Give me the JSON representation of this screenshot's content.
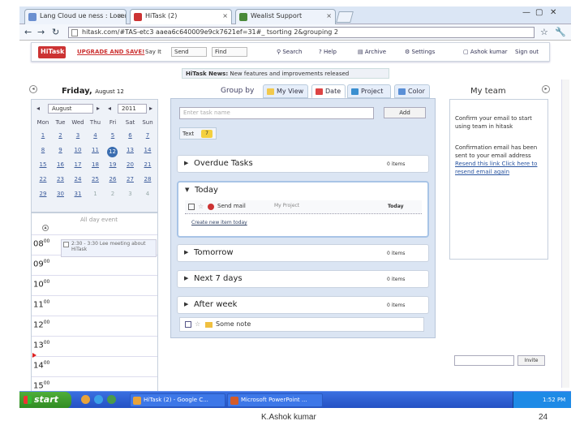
{
  "browser": {
    "tabs": [
      {
        "label": "Lang Cloud ue ness : Locen"
      },
      {
        "label": "HiTask (2)"
      },
      {
        "label": "Wealist Support"
      }
    ],
    "url": "hitask.com/#TAS-etc3 aaea6c640009e9ck7621ef=31#_ tsorting 2&grouping 2"
  },
  "hitask": {
    "logo": "HiTask",
    "upgrade": "UPGRADE AND SAVE!",
    "say_it": "Say It",
    "say_fields": [
      "Send",
      "Find"
    ],
    "nav": [
      "Search",
      "Help",
      "Archive",
      "Settings"
    ],
    "user": "Ashok kumar",
    "sign_out": "Sign out",
    "news_label": "HiTask News:",
    "news_text": "New features and improvements released"
  },
  "calendar": {
    "day_title": "Friday,",
    "day_date": "August 12",
    "month": "August",
    "year": "2011",
    "dow": [
      "Mon",
      "Tue",
      "Wed",
      "Thu",
      "Fri",
      "Sat",
      "Sun"
    ],
    "weeks": [
      [
        "1",
        "2",
        "3",
        "4",
        "5",
        "6",
        "7"
      ],
      [
        "8",
        "9",
        "10",
        "11",
        "12",
        "13",
        "14"
      ],
      [
        "15",
        "16",
        "17",
        "18",
        "19",
        "20",
        "21"
      ],
      [
        "22",
        "23",
        "24",
        "25",
        "26",
        "27",
        "28"
      ],
      [
        "29",
        "30",
        "31",
        "1",
        "2",
        "3",
        "4"
      ]
    ],
    "all_day": "All day event",
    "event": "2:30 - 3:30 Lee meeting about HiTask",
    "hours": [
      {
        "h": "08",
        "m": "00"
      },
      {
        "h": "09",
        "m": "00"
      },
      {
        "h": "10",
        "m": "00"
      },
      {
        "h": "11",
        "m": "00"
      },
      {
        "h": "12",
        "m": "00"
      },
      {
        "h": "13",
        "m": "00"
      },
      {
        "h": "14",
        "m": "00"
      },
      {
        "h": "15",
        "m": "00"
      }
    ]
  },
  "groupby": {
    "label": "Group by",
    "tabs": [
      "My View",
      "Date",
      "Project",
      "Color"
    ]
  },
  "tasks": {
    "placeholder": "Enter task name",
    "add": "Add",
    "text_tab": "Text",
    "text_badge": "7",
    "groups": [
      {
        "title": "Overdue Tasks",
        "count": "0 items"
      },
      {
        "title": "Tomorrow",
        "count": "0 items"
      },
      {
        "title": "Next 7 days",
        "count": "0 items"
      },
      {
        "title": "After week",
        "count": "0 items"
      }
    ],
    "today": {
      "title": "Today",
      "task": "Send mail",
      "project": "My Project",
      "due": "Today",
      "link": "Create new item today"
    },
    "some_note": "Some note"
  },
  "team": {
    "title": "My team",
    "confirm": "Confirm your email to start using team in hitask",
    "info": "Confirmation email has been sent to your email address",
    "resend": "Resend this link Click here to resend email again",
    "invite": "Invite"
  },
  "taskbar": {
    "start": "start",
    "buttons": [
      "HiTask (2) - Google C...",
      "Microsoft PowerPoint ..."
    ],
    "clock": "1:52 PM"
  },
  "slide": {
    "author": "K.Ashok kumar",
    "page": "24"
  }
}
